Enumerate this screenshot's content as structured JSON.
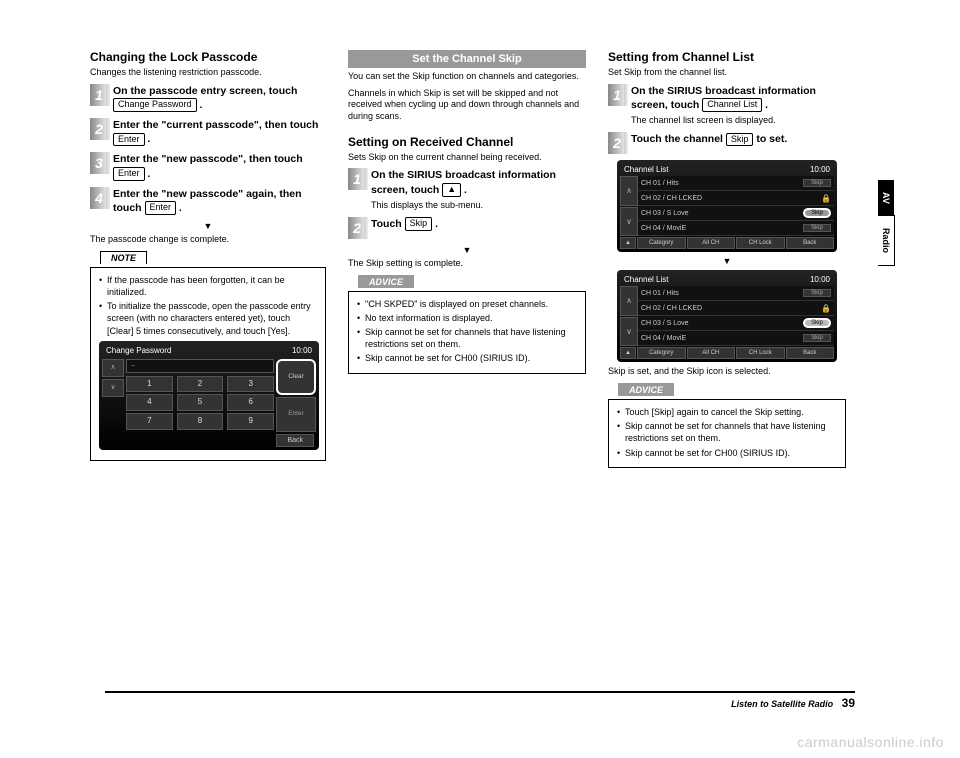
{
  "domain": "Document",
  "sidetabs": {
    "av": "AV",
    "radio": "Radio"
  },
  "footer": {
    "section": "Listen to Satellite Radio",
    "page": "39"
  },
  "watermark": "carmanualsonline.info",
  "col1": {
    "h": "Changing the Lock Passcode",
    "sub": "Changes the listening restriction passcode.",
    "steps": [
      {
        "n": "1",
        "t1": "On the passcode entry screen, touch ",
        "btn": "Change Password",
        "t2": " ."
      },
      {
        "n": "2",
        "t1": "Enter the \"current passcode\", then touch ",
        "btn": "Enter",
        "t2": " ."
      },
      {
        "n": "3",
        "t1": "Enter the \"new passcode\", then touch ",
        "btn": "Enter",
        "t2": " ."
      },
      {
        "n": "4",
        "t1": "Enter the \"new passcode\" again, then touch ",
        "btn": "Enter",
        "t2": " ."
      }
    ],
    "arrow": "▼",
    "result": "The passcode change is complete.",
    "note_label": "NOTE",
    "note": [
      "If the passcode has been forgotten, it can be initialized.",
      "To initialize the passcode, open the passcode entry screen (with no characters entered yet), touch [Clear] 5 times consecutively, and touch [Yes]."
    ],
    "screen": {
      "title": "Change Password",
      "time": "10:00",
      "input": "–",
      "keys": [
        [
          "1",
          "2",
          "3"
        ],
        [
          "4",
          "5",
          "6"
        ],
        [
          "7",
          "8",
          "9"
        ]
      ],
      "clear": "Clear",
      "enter": "Enter",
      "back": "Back"
    }
  },
  "col2": {
    "bar": "Set the Channel Skip",
    "sub1": "You can set the Skip function on channels and categories.",
    "sub2": "Channels in which Skip is set will be skipped and not received when cycling up and down through channels and during scans.",
    "h2": "Setting on Received Channel",
    "sub3": "Sets Skip on the current channel being received.",
    "steps": [
      {
        "n": "1",
        "t1": "On the SIRIUS broadcast information screen, touch ",
        "btn": "▲",
        "t2": " .",
        "subtext": "This displays the sub-menu."
      },
      {
        "n": "2",
        "t1": "Touch ",
        "btn": "Skip",
        "t2": " ."
      }
    ],
    "arrow": "▼",
    "result": "The Skip setting is complete.",
    "adv_label": "ADVICE",
    "adv": [
      "\"CH SKPED\" is displayed on preset channels.",
      "No text information is displayed.",
      "Skip cannot be set for channels that have listening restrictions set on them.",
      "Skip cannot be set for CH00 (SIRIUS ID)."
    ]
  },
  "col3": {
    "h": "Setting from Channel List",
    "sub": "Set Skip from the channel list.",
    "steps": [
      {
        "n": "1",
        "t1": "On the SIRIUS broadcast information screen, touch ",
        "btn": "Channel List",
        "t2": " .",
        "subtext": "The channel list screen is displayed."
      },
      {
        "n": "2",
        "t1": "Touch the channel ",
        "btn": "Skip",
        "t2": " to set."
      }
    ],
    "screen": {
      "title": "Channel  List",
      "time": "10:00",
      "rows": [
        {
          "txt": "CH 01 / Hits",
          "lock": "",
          "skip": "Skip"
        },
        {
          "txt": "CH 02 / CH LCKED",
          "lock": "🔒",
          "skip": ""
        },
        {
          "txt": "CH 03 / S Love",
          "lock": "",
          "skip": "Skip",
          "hl": true
        },
        {
          "txt": "CH 04 / MoviE",
          "lock": "",
          "skip": "Skip"
        }
      ],
      "btm": [
        "▲",
        "Category",
        "All CH",
        "CH Lock",
        "Back"
      ]
    },
    "arrow": "▼",
    "screen2": {
      "title": "Channel  List",
      "time": "10:00",
      "rows": [
        {
          "txt": "CH 01 / Hits",
          "lock": "",
          "skip": "Skip"
        },
        {
          "txt": "CH 02 / CH LCKED",
          "lock": "🔒",
          "skip": ""
        },
        {
          "txt": "CH 03 / S Love",
          "lock": "",
          "skip": "Skip",
          "sel": true
        },
        {
          "txt": "CH 04 / MoviE",
          "lock": "",
          "skip": "Skip"
        }
      ],
      "btm": [
        "▲",
        "Category",
        "All CH",
        "CH Lock",
        "Back"
      ]
    },
    "result": "Skip is set, and the Skip icon is selected.",
    "adv_label": "ADVICE",
    "adv": [
      "Touch [Skip] again to cancel the Skip setting.",
      "Skip cannot be set for channels that have listening restrictions set on them.",
      "Skip cannot be set for CH00 (SIRIUS ID)."
    ]
  }
}
